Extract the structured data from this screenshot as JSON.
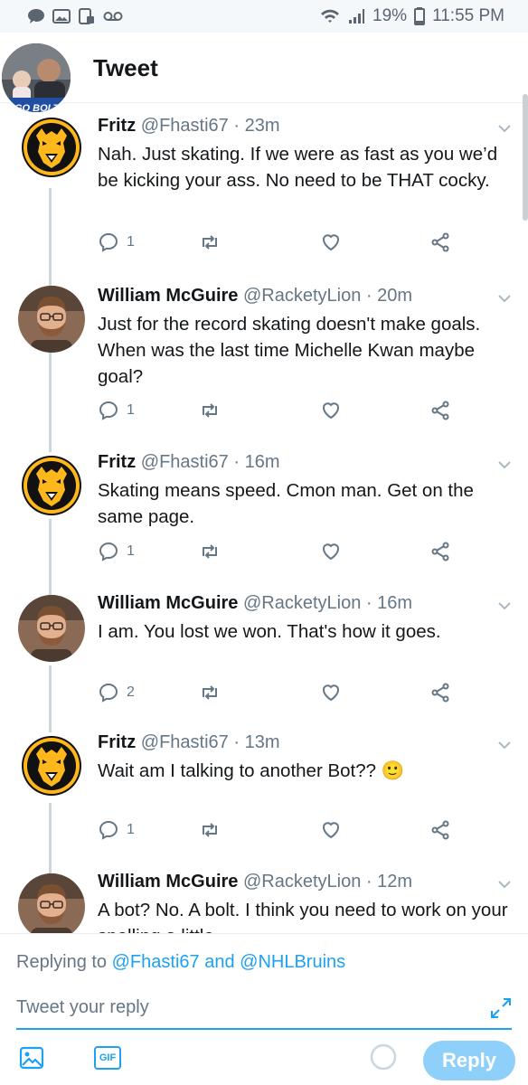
{
  "status_bar": {
    "battery": "19%",
    "time": "11:55 PM"
  },
  "header": {
    "title": "Tweet",
    "avatar_badge": "GO BOLTS!"
  },
  "tweets": [
    {
      "name": "Fritz",
      "handle": "@Fhasti67",
      "time": "23m",
      "text": "Nah. Just skating. If we were as fast as you we’d be kicking your ass.  No need to be THAT cocky.",
      "reply_count": "1"
    },
    {
      "name": "William McGuire",
      "handle": "@RacketyLion",
      "time": "20m",
      "text": "Just for the record skating doesn't make goals. When was the last time Michelle Kwan maybe goal?",
      "reply_count": "1"
    },
    {
      "name": "Fritz",
      "handle": "@Fhasti67",
      "time": "16m",
      "text": "Skating means speed. Cmon man. Get on the same page.",
      "reply_count": "1"
    },
    {
      "name": "William McGuire",
      "handle": "@RacketyLion",
      "time": "16m",
      "text": "I am. You lost we won. That's how it goes.",
      "reply_count": "2"
    },
    {
      "name": "Fritz",
      "handle": "@Fhasti67",
      "time": "13m",
      "text": "Wait am I talking to another Bot?? 🙂",
      "reply_count": "1"
    },
    {
      "name": "William McGuire",
      "handle": "@RacketyLion",
      "time": "12m",
      "text": "A bot? No. A bolt. I think you need to work on your spelling a little.",
      "reply_count": ""
    }
  ],
  "reply": {
    "replying_prefix": "Replying to",
    "handle_1": "@Fhasti67",
    "and_word": "and",
    "handle_2": "@NHLBruins",
    "placeholder": "Tweet your reply",
    "gif_label": "GIF",
    "button_label": "Reply"
  },
  "colors": {
    "accent": "#1da1f2",
    "accent_disabled": "#8ed0f9",
    "secondary_text": "#657786",
    "bruins_gold": "#ffb81c"
  }
}
